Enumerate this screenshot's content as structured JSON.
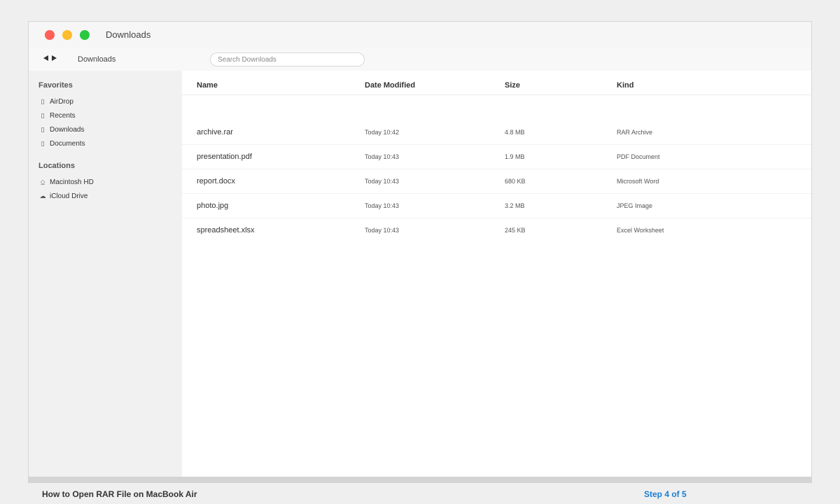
{
  "window": {
    "title": "Downloads",
    "toolbar_path": "Downloads",
    "search_placeholder": "Search Downloads"
  },
  "sidebar": {
    "favorites_title": "Favorites",
    "favorites": [
      {
        "label": "AirDrop",
        "icon": "folder-icon"
      },
      {
        "label": "Recents",
        "icon": "folder-icon"
      },
      {
        "label": "Downloads",
        "icon": "folder-icon"
      },
      {
        "label": "Documents",
        "icon": "folder-icon"
      }
    ],
    "locations_title": "Locations",
    "locations": [
      {
        "label": "Macintosh HD",
        "icon": "disk-icon"
      },
      {
        "label": "iCloud Drive",
        "icon": "cloud-icon"
      }
    ]
  },
  "table": {
    "columns": [
      "Name",
      "Date Modified",
      "Size",
      "Kind"
    ],
    "rows": [
      {
        "name": "archive.rar",
        "date": "Today 10:42",
        "size": "4.8 MB",
        "kind": "RAR Archive"
      },
      {
        "name": "presentation.pdf",
        "date": "Today 10:43",
        "size": "1.9 MB",
        "kind": "PDF Document"
      },
      {
        "name": "report.docx",
        "date": "Today 10:43",
        "size": "680 KB",
        "kind": "Microsoft Word"
      },
      {
        "name": "photo.jpg",
        "date": "Today 10:43",
        "size": "3.2 MB",
        "kind": "JPEG Image"
      },
      {
        "name": "spreadsheet.xlsx",
        "date": "Today 10:43",
        "size": "245 KB",
        "kind": "Excel Worksheet"
      }
    ]
  },
  "footer": {
    "title": "How to Open RAR File on MacBook Air",
    "step": "Step 4 of 5"
  },
  "colors": {
    "close": "#ff5f57",
    "minimize": "#febc2e",
    "maximize": "#28c840",
    "step_accent": "#1a7fd4"
  }
}
